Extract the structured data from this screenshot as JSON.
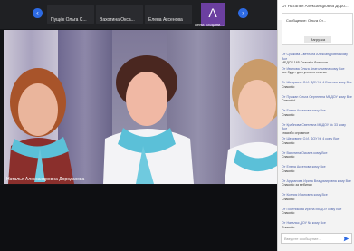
{
  "participants": [
    {
      "name": "Пущёк Ольга С..."
    },
    {
      "name": "Вахотина Окса..."
    },
    {
      "name": "Елена Аксенова"
    }
  ],
  "avatar": {
    "initial": "A",
    "name": "Анна Владим..."
  },
  "nav": {
    "prev": "‹",
    "next": "›"
  },
  "speaker": {
    "name": "Наталья Александровна Дородахова"
  },
  "colors": {
    "accent": "#2d6ae3",
    "avatar": "#6b3fa0",
    "scarf": "#5bc0d8"
  },
  "chat": {
    "header": "От Наталья Александровна Доро...",
    "popup": {
      "text": "Сообщение: Ольга Ст...",
      "button": "Загрузка"
    },
    "messages": [
      {
        "from": "От Сушкова Светлана Александровна кому Все",
        "body": "МБДОУ 165 Спасибо большое"
      },
      {
        "from": "От Иванова Ольга Анатольевна кому Все",
        "body": "все будет доступно по ссылке"
      },
      {
        "from": "От Шеарвине О.И. ДОУ № 4 Евгения кому Все",
        "body": "Спасибо"
      },
      {
        "from": "От Пушкан Ольга Сергеевна МБДОУ кому Все",
        "body": "Спасибо!"
      },
      {
        "from": "От Елена Аксенова кому Все",
        "body": "Спасибо"
      },
      {
        "from": "От Крайнова Светлана МБДОУ № 33 кому Все",
        "body": "спасибо огромное"
      },
      {
        "from": "От Шеарвине О.И. ДОУ № 4 кому Все",
        "body": "Спасибо"
      },
      {
        "from": "От Вахотина Оксана кому Все",
        "body": "Спасибо"
      },
      {
        "from": "От Елена Аксенова кому Все",
        "body": "Спасибо"
      },
      {
        "from": "От Аруханова Ирина Владимировна кому Все",
        "body": "Спасибо за вебинар"
      },
      {
        "from": "От Ксения Ивановна кому Все",
        "body": "Спасибо"
      },
      {
        "from": "От Постникова Ирина МБДОУ кому Все",
        "body": "Спасибо"
      },
      {
        "from": "От Наталья ДОУ № кому Все",
        "body": "Спасибо"
      }
    ],
    "input_placeholder": "Введите сообщение..."
  }
}
